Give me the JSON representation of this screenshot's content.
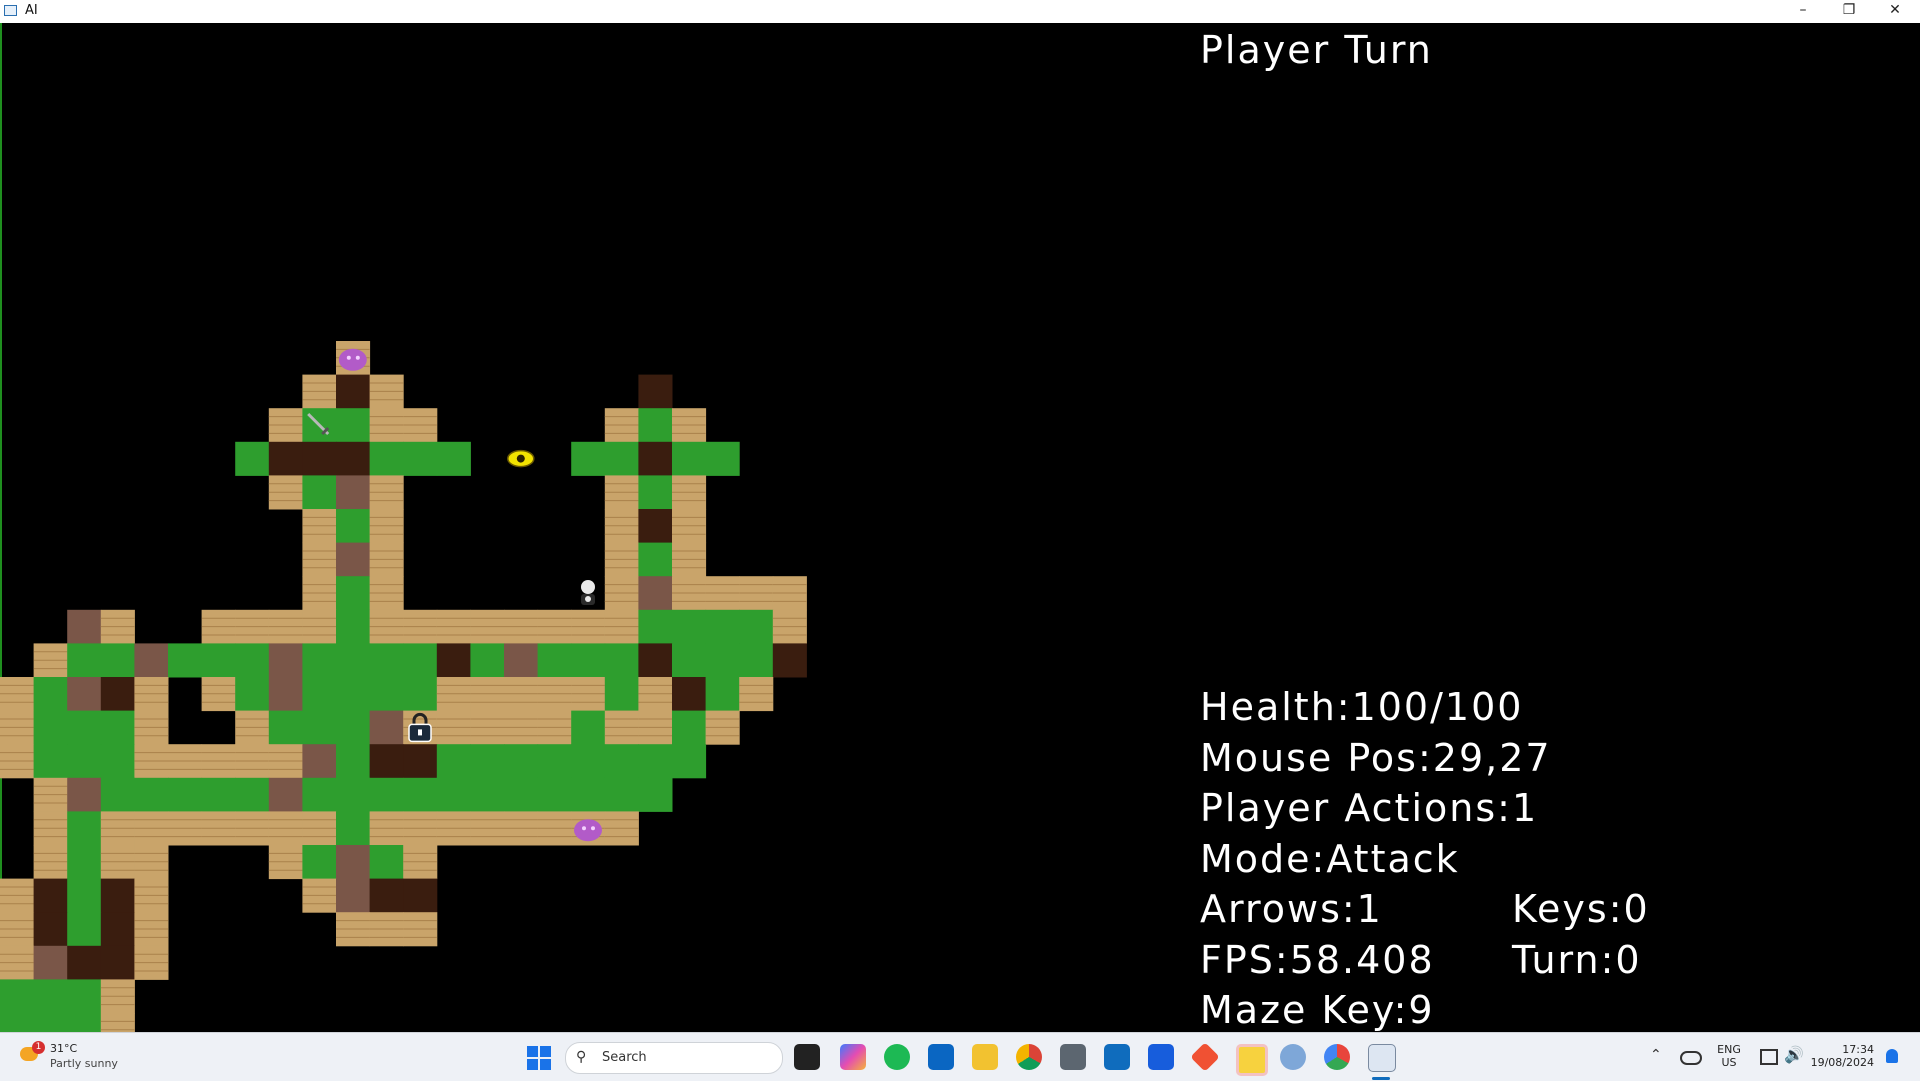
{
  "window": {
    "title": "AI",
    "controls": [
      "minimize",
      "restore",
      "close"
    ]
  },
  "hud": {
    "header": "Player Turn",
    "health": "Health:100/100",
    "mouse_pos": "Mouse Pos:29,27",
    "player_actions": "Player Actions:1",
    "mode": "Mode:Attack",
    "arrows": "Arrows:1",
    "keys": "Keys:0",
    "fps": "FPS:58.408",
    "turn": "Turn:0",
    "maze_key": "Maze Key:9"
  },
  "colors": {
    "grass": "#2e9e2e",
    "plank": "#c9a46a",
    "dirt": "#3a1d0f",
    "stone": "#7a5648",
    "background": "#000000",
    "enemy": "#b25bc8"
  },
  "map": {
    "rows": [
      "..........P.............",
      ".........PDP.......D....",
      "........PGGPP.....PGP...",
      ".......GDDDGGG...GGDGG..",
      "........PGSP......PGP...",
      ".........PGP......PDP...",
      ".........PSP......PGP...",
      ".........PGP......PSPPPP",
      "..SP..PPPPGPPPPPPPPGGGGP",
      ".PGGSGGGSGGGGDGSGGGDGGGD",
      "PGSDP.PGSGGGGPPPPPGPDGP.",
      "PGGGP..PGGGSPPPPPGPPGP..",
      "PGGGPPPPPSGDDGGGGGGGG...",
      ".PSGGGGGSGGGGGGGGGGG....",
      ".PGPPPPPPPGPPPPPPPP.....",
      ".PGPP...PGSGP...........",
      "PDGDP....PSDD...........",
      "PDGDP.....PPP...........",
      "PSDDP...................",
      "GGGP....................",
      "GGGP...................."
    ],
    "objects": [
      {
        "type": "enemy-slime",
        "icon": "purple-slime-icon"
      },
      {
        "type": "sword",
        "icon": "sword-icon"
      },
      {
        "type": "eye",
        "icon": "eye-icon"
      },
      {
        "type": "player",
        "icon": "player-icon"
      },
      {
        "type": "lock",
        "icon": "lock-icon"
      },
      {
        "type": "enemy-slime",
        "icon": "purple-slime-icon"
      }
    ]
  },
  "taskbar": {
    "weather_temp": "31°C",
    "weather_desc": "Partly sunny",
    "weather_badge": "1",
    "search_placeholder": "Search",
    "lang_top": "ENG",
    "lang_bottom": "US",
    "time": "17:34",
    "date": "19/08/2024"
  }
}
